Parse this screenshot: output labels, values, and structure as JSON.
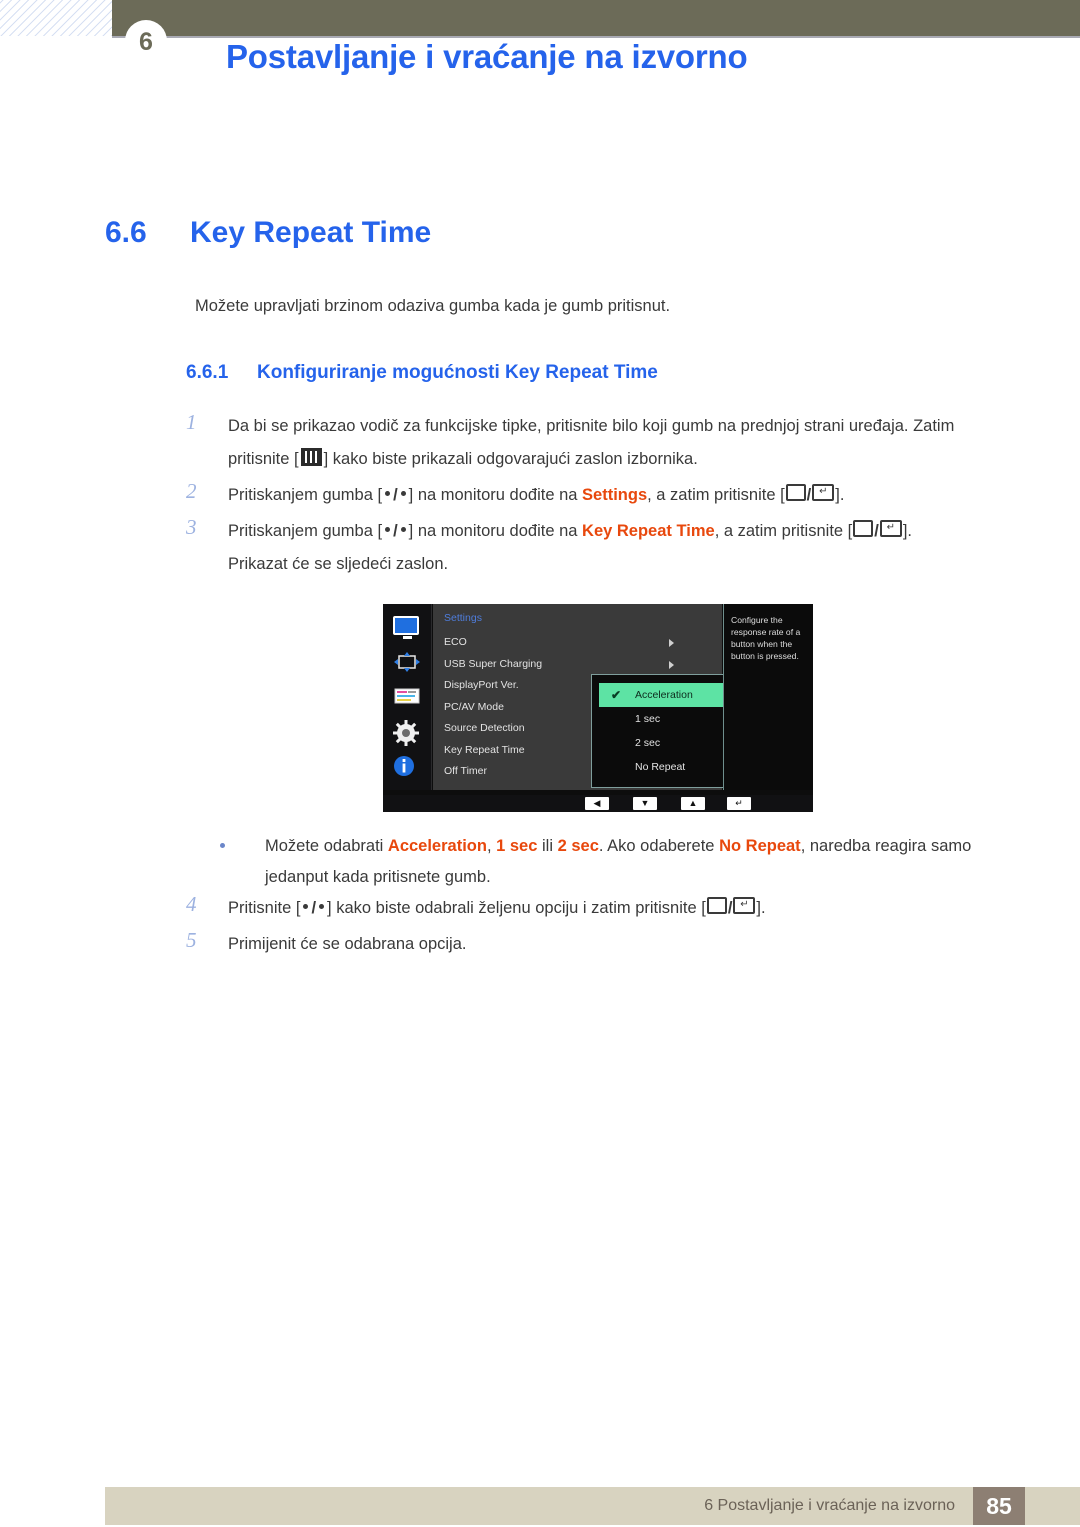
{
  "header": {
    "chapter_badge": "6",
    "title": "Postavljanje i vraćanje na izvorno"
  },
  "section": {
    "number": "6.6",
    "title": "Key Repeat Time",
    "intro": "Možete upravljati brzinom odaziva gumba kada je gumb pritisnut.",
    "sub_number": "6.6.1",
    "sub_title": "Konfiguriranje mogućnosti Key Repeat Time"
  },
  "steps": [
    {
      "num": "1",
      "part1": "Da bi se prikazao vodič za funkcijske tipke, pritisnite bilo koji gumb na prednjoj strani uređaja. Zatim pritisnite [",
      "part2": "] kako biste prikazali odgovarajući zaslon izbornika."
    },
    {
      "num": "2",
      "p1": "Pritiskanjem gumba [",
      "p2": "] na monitoru dođite na ",
      "highlight": "Settings",
      "p3": ", a zatim pritisnite [",
      "p4": "]."
    },
    {
      "num": "3",
      "p1": "Pritiskanjem gumba [",
      "p2": "] na monitoru dođite na ",
      "highlight": "Key Repeat Time",
      "p3": ", a zatim pritisnite [",
      "p4": "].",
      "p5": "Prikazat će se sljedeći zaslon."
    },
    {
      "num": "4",
      "p1": "Pritisnite [",
      "p2": "] kako biste odabrali željenu opciju i zatim pritisnite [",
      "p3": "]."
    },
    {
      "num": "5",
      "p1": "Primijenit će se odabrana opcija."
    }
  ],
  "osd": {
    "menu_title": "Settings",
    "items": [
      {
        "label": "ECO",
        "has_arrow": true
      },
      {
        "label": "USB Super Charging",
        "has_arrow": true
      },
      {
        "label": "DisplayPort Ver.",
        "has_arrow": false
      },
      {
        "label": "PC/AV Mode",
        "has_arrow": false
      },
      {
        "label": "Source Detection",
        "has_arrow": false
      },
      {
        "label": "Key Repeat Time",
        "has_arrow": false
      },
      {
        "label": "Off Timer",
        "has_arrow": false
      }
    ],
    "submenu": [
      {
        "label": "Acceleration",
        "selected": true,
        "check": "✔"
      },
      {
        "label": "1 sec",
        "selected": false
      },
      {
        "label": "2 sec",
        "selected": false
      },
      {
        "label": "No Repeat",
        "selected": false
      }
    ],
    "help_text": "Configure the response rate of a button when the button is pressed.",
    "bottom_buttons": [
      "◀",
      "▼",
      "▲",
      "↵"
    ],
    "sidebar_icons": [
      "monitor-icon",
      "picture-size-icon",
      "onscreen-display-icon",
      "settings-gear-icon",
      "information-icon"
    ],
    "accent_color": "#5de3a4"
  },
  "note": {
    "p1": "Možete odabrati ",
    "h1": "Acceleration",
    "p2": ", ",
    "h2": "1 sec",
    "p3": " ili ",
    "h3": "2 sec",
    "p4": ". Ako odaberete ",
    "h4": "No Repeat",
    "p5": ", naredba reagira samo jedanput kada pritisnete gumb."
  },
  "footer": {
    "text": "6 Postavljanje i vraćanje na izvorno",
    "page": "85"
  }
}
